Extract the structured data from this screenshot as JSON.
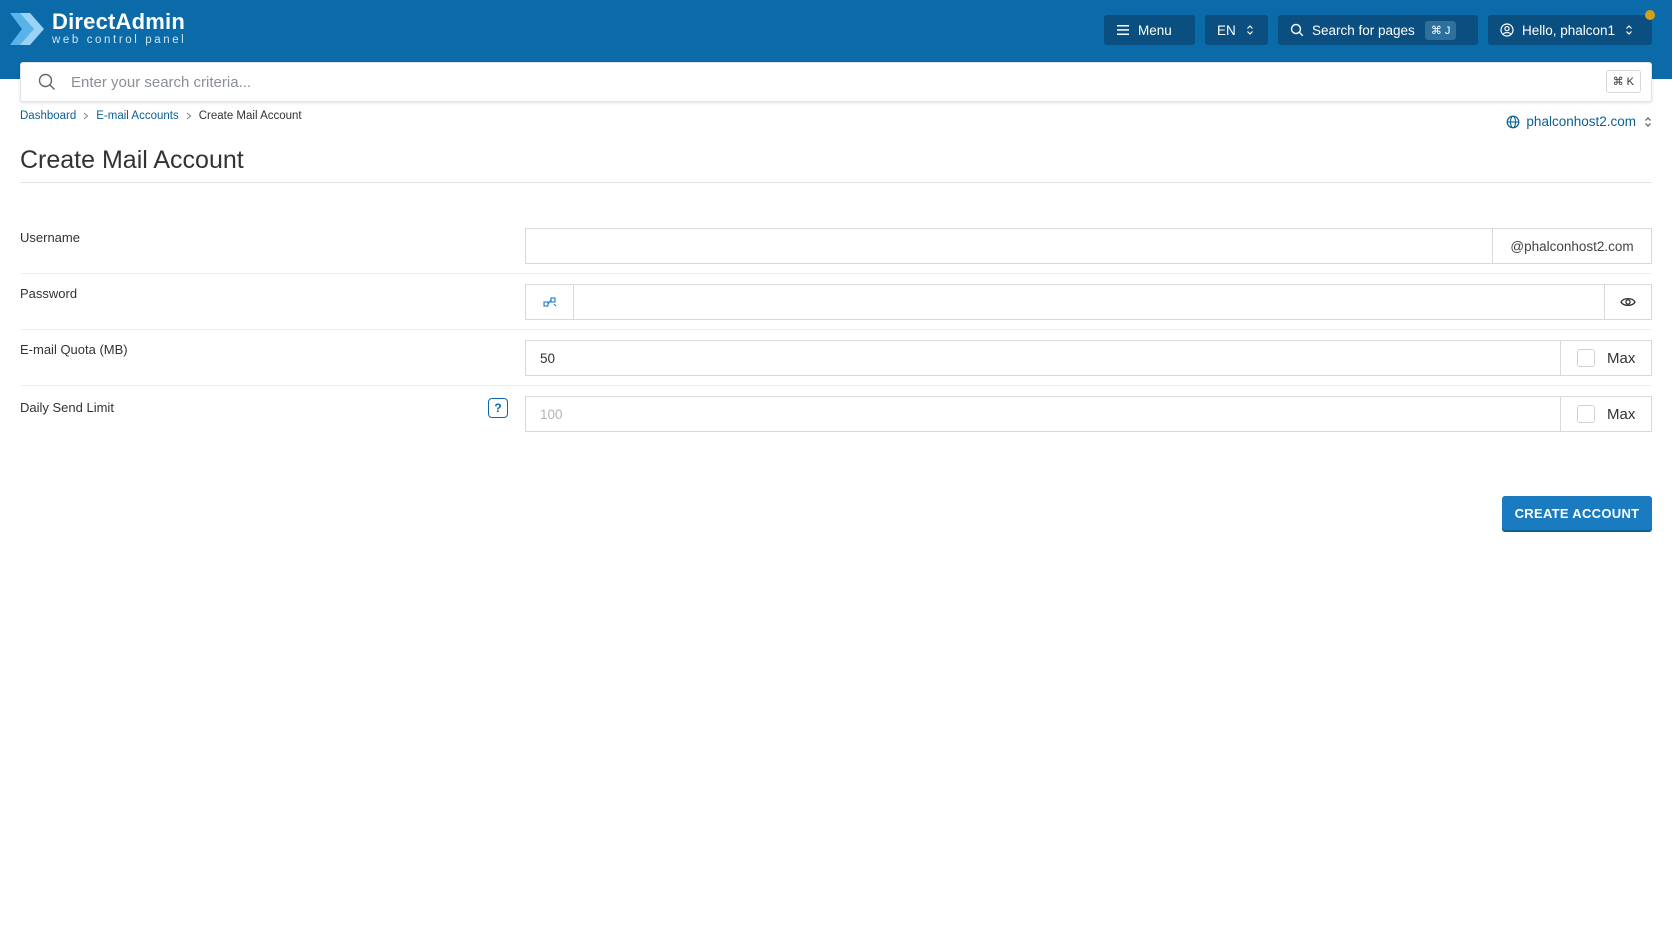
{
  "header": {
    "logo_title": "DirectAdmin",
    "logo_subtitle": "web control panel",
    "menu_label": "Menu",
    "language": "EN",
    "search_pages_label": "Search for pages",
    "search_pages_shortcut": "⌘ J",
    "user_greeting": "Hello, phalcon1",
    "brand_color": "#0b6aa8",
    "notification_dot_color": "#d4a017"
  },
  "search": {
    "placeholder": "Enter your search criteria...",
    "shortcut": "⌘ K"
  },
  "breadcrumb": {
    "items": [
      "Dashboard",
      "E-mail Accounts",
      "Create Mail Account"
    ]
  },
  "domain_selector": {
    "value": "phalconhost2.com"
  },
  "page": {
    "title": "Create Mail Account"
  },
  "form": {
    "username": {
      "label": "Username",
      "value": "",
      "suffix": "@phalconhost2.com"
    },
    "password": {
      "label": "Password",
      "value": ""
    },
    "quota": {
      "label": "E-mail Quota (MB)",
      "value": "50",
      "max_label": "Max",
      "max_checked": false
    },
    "send_limit": {
      "label": "Daily Send Limit",
      "value": "",
      "placeholder": "100",
      "max_label": "Max",
      "max_checked": false,
      "help": "?"
    },
    "submit_label": "CREATE ACCOUNT"
  }
}
